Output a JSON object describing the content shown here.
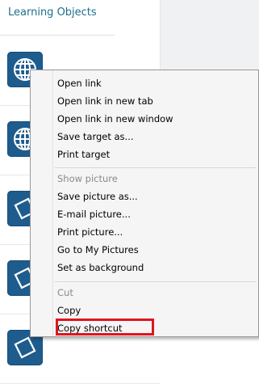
{
  "panel": {
    "title": "Learning Objects",
    "objects": [
      {
        "icon": "globe-icon"
      },
      {
        "icon": "globe-icon"
      },
      {
        "icon": "picture-icon"
      },
      {
        "icon": "picture-icon"
      },
      {
        "icon": "picture-icon"
      }
    ]
  },
  "context_menu": {
    "groups": [
      [
        {
          "label": "Open link",
          "enabled": true
        },
        {
          "label": "Open link in new tab",
          "enabled": true
        },
        {
          "label": "Open link in new window",
          "enabled": true
        },
        {
          "label": "Save target as...",
          "enabled": true
        },
        {
          "label": "Print target",
          "enabled": true
        }
      ],
      [
        {
          "label": "Show picture",
          "enabled": false
        },
        {
          "label": "Save picture as...",
          "enabled": true
        },
        {
          "label": "E-mail picture...",
          "enabled": true
        },
        {
          "label": "Print picture...",
          "enabled": true
        },
        {
          "label": "Go to My Pictures",
          "enabled": true
        },
        {
          "label": "Set as background",
          "enabled": true
        }
      ],
      [
        {
          "label": "Cut",
          "enabled": false
        },
        {
          "label": "Copy",
          "enabled": true
        },
        {
          "label": "Copy shortcut",
          "enabled": true,
          "highlighted": true
        }
      ]
    ]
  },
  "colors": {
    "title": "#1f6e8c",
    "tile": "#1e5c8e",
    "highlight_box": "#e0141e",
    "disabled_text": "#8a8a8a"
  }
}
